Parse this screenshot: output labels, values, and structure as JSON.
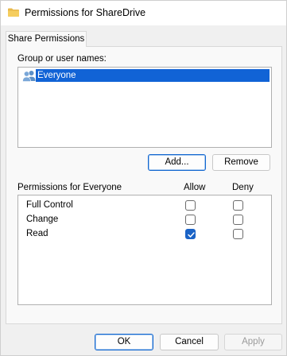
{
  "window": {
    "title": "Permissions for ShareDrive"
  },
  "tabs": [
    {
      "label": "Share Permissions"
    }
  ],
  "group_section": {
    "label": "Group or user names:",
    "items": [
      {
        "name": "Everyone",
        "selected": true,
        "icon": "users-icon"
      }
    ]
  },
  "group_buttons": {
    "add": "Add...",
    "remove": "Remove"
  },
  "permissions": {
    "header_label": "Permissions for Everyone",
    "allow_label": "Allow",
    "deny_label": "Deny",
    "rows": [
      {
        "name": "Full Control",
        "allow": false,
        "deny": false
      },
      {
        "name": "Change",
        "allow": false,
        "deny": false
      },
      {
        "name": "Read",
        "allow": true,
        "deny": false
      }
    ]
  },
  "footer_buttons": {
    "ok": "OK",
    "cancel": "Cancel",
    "apply": "Apply"
  },
  "colors": {
    "selection": "#1163d6",
    "checkbox_checked": "#1a63c6",
    "focus_border": "#1267d0",
    "folder_icon": "#e8b84a"
  }
}
